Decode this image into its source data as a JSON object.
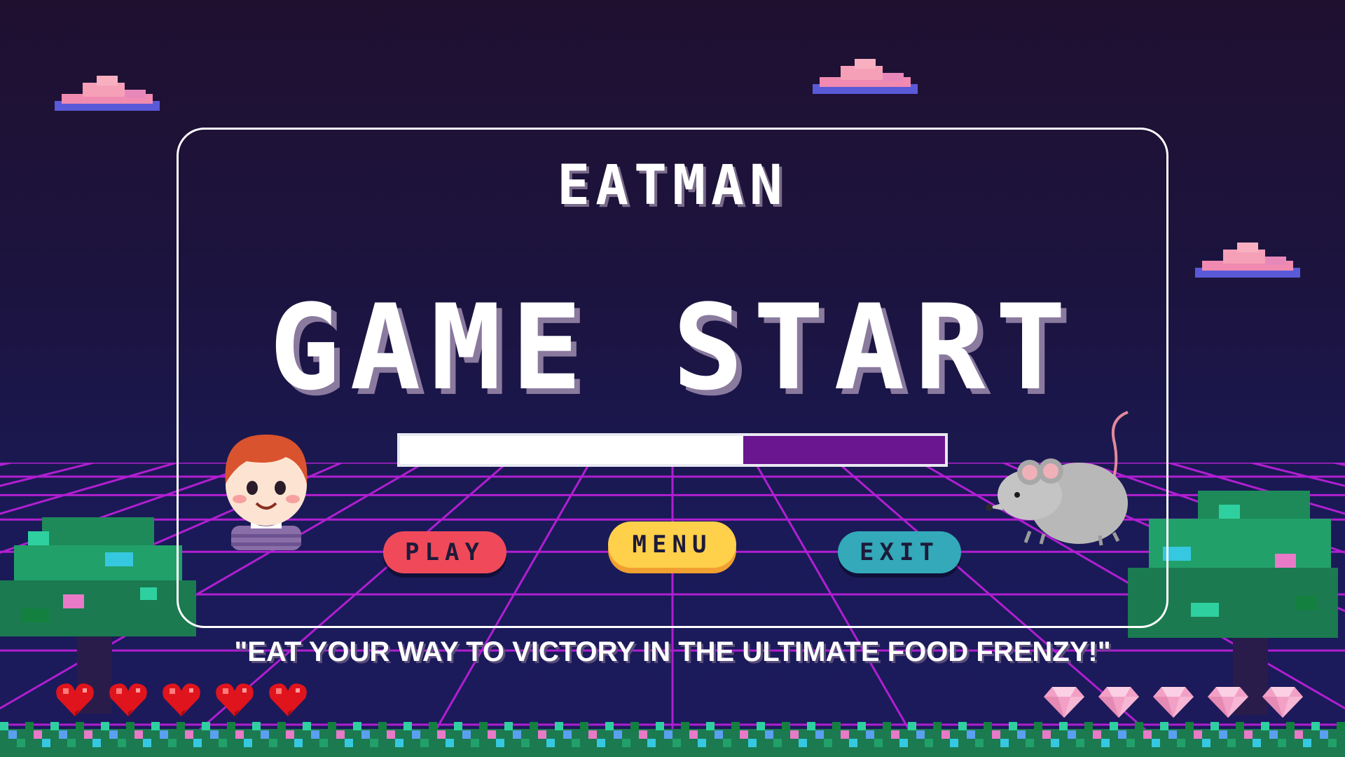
{
  "game": {
    "logo": "EATMAN",
    "headline": "GAME START",
    "tagline": "\"EAT YOUR WAY TO VICTORY IN THE ULTIMATE FOOD FRENZY!\"",
    "loading_progress": 0.63
  },
  "buttons": {
    "play": "PLAY",
    "menu": "MENU",
    "exit": "EXIT"
  },
  "status": {
    "lives": 5,
    "gems": 5
  },
  "colors": {
    "background": "#1c1440",
    "grid_line": "#b01fd0",
    "play_button": "#f04a5a",
    "menu_button": "#ffd04a",
    "exit_button": "#33a9b9",
    "progress_empty": "#6a1690",
    "progress_fill": "#ffffff"
  },
  "icons": [
    "cloud-icon",
    "heart-icon",
    "gem-icon",
    "tree-icon",
    "boy-character",
    "mouse-character"
  ]
}
